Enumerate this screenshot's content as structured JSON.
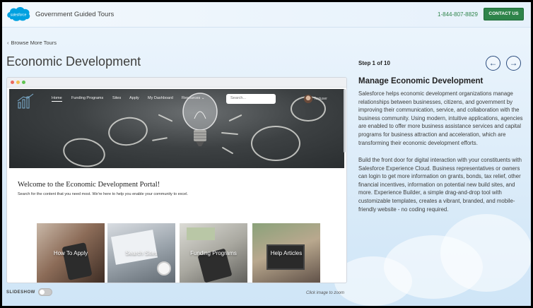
{
  "header": {
    "logo_text": "salesforce",
    "title": "Government Guided Tours",
    "phone": "1-844-807-8829",
    "contact_label": "CONTACT US"
  },
  "nav": {
    "back_label": "Browse More Tours"
  },
  "page": {
    "title": "Economic Development"
  },
  "screenshot": {
    "site_nav": [
      "Home",
      "Funding Programs",
      "Sites",
      "Apply",
      "My Dashboard",
      "Resources"
    ],
    "search_placeholder": "Search...",
    "user_name": "Testuser",
    "welcome_title": "Welcome to the Economic Development Portal!",
    "welcome_sub": "Search for the content that you need most. We're here to help you enable your community to excel.",
    "cards": [
      "How To Apply",
      "Search Sites",
      "Funding Programs",
      "Help Articles"
    ]
  },
  "footer": {
    "slideshow_label": "SLIDESHOW",
    "slideshow_on": false,
    "zoom_hint": "Click image to zoom"
  },
  "panel": {
    "step": "Step 1 of 10",
    "title": "Manage Economic Development",
    "p1": "Salesforce helps economic development organizations manage relationships between businesses, citizens, and government by improving their communication, service, and collaboration with the business community. Using modern, intuitive applications, agencies are enabled to offer more business assistance services and capital programs for business attraction and acceleration, which are transforming their economic development efforts.",
    "p2": "Build the front door for digital interaction with your constituents with Salesforce Experience Cloud. Business representatives or owners can login to get more information on grants, bonds, tax relief, other financial incentives, information on potential new build sites, and more. Experience Builder, a simple drag-and-drop tool with customizable templates, creates a vibrant, branded, and mobile-friendly website - no coding required."
  },
  "colors": {
    "accent_green": "#2e844a",
    "nav_blue": "#2b4c7e",
    "logo_blue": "#00a1e0"
  },
  "icons": {
    "back": "chevron-left-icon",
    "prev": "arrow-left-icon",
    "next": "arrow-right-icon"
  }
}
